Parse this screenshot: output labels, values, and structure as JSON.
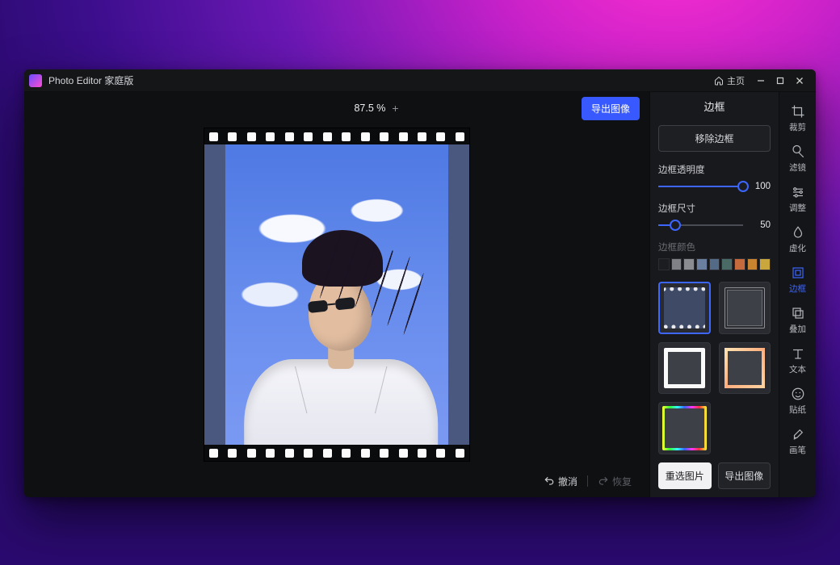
{
  "titlebar": {
    "app_title": "Photo Editor 家庭版",
    "home_label": "主页"
  },
  "canvas": {
    "zoom_label": "87.5 %",
    "export_label": "导出图像",
    "undo_label": "撤消",
    "redo_label": "恢复"
  },
  "options": {
    "panel_title": "边框",
    "remove_label": "移除边框",
    "opacity": {
      "label": "边框透明度",
      "value": 100,
      "pct": 100
    },
    "size": {
      "label": "边框尺寸",
      "value": 50,
      "pct": 20
    },
    "color_label": "边框颜色",
    "color_swatches": [
      "#1c1d21",
      "#7f8187",
      "#8a8c92",
      "#6b7fa0",
      "#546b87",
      "#4a6a66",
      "#c46a3d",
      "#c9842f",
      "#c9a73d"
    ],
    "presets": [
      {
        "id": "film",
        "selected": true
      },
      {
        "id": "thin",
        "selected": false
      },
      {
        "id": "thick",
        "selected": false
      },
      {
        "id": "warm",
        "selected": false
      },
      {
        "id": "rainbow",
        "selected": false
      }
    ],
    "reselect_label": "重选图片",
    "export_label": "导出图像"
  },
  "rail": {
    "tools": [
      {
        "id": "crop",
        "label": "裁剪",
        "active": false
      },
      {
        "id": "filters",
        "label": "滤镜",
        "active": false
      },
      {
        "id": "adjust",
        "label": "调整",
        "active": false
      },
      {
        "id": "blur",
        "label": "虚化",
        "active": false
      },
      {
        "id": "frame",
        "label": "边框",
        "active": true
      },
      {
        "id": "overlay",
        "label": "叠加",
        "active": false
      },
      {
        "id": "text",
        "label": "文本",
        "active": false
      },
      {
        "id": "sticker",
        "label": "贴纸",
        "active": false
      },
      {
        "id": "brush",
        "label": "画笔",
        "active": false
      }
    ]
  }
}
